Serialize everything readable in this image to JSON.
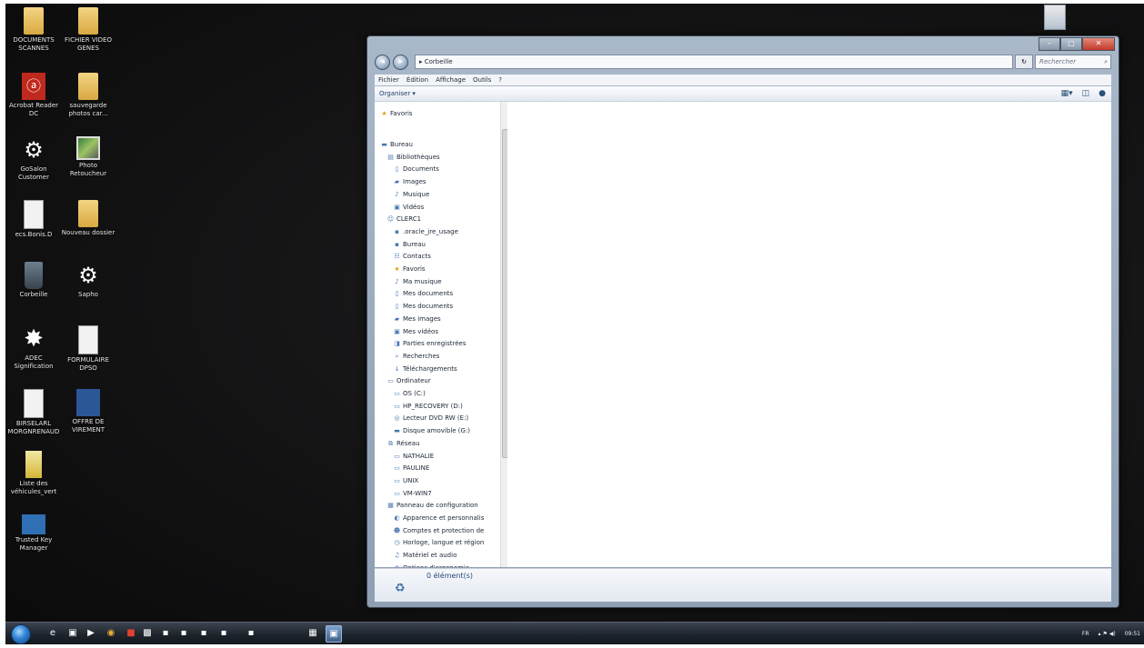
{
  "desktop": {
    "icons": [
      {
        "label": "DOCUMENTS SCANNES",
        "icon": "folder-document-icon"
      },
      {
        "label": "FICHIER VIDEO GENES",
        "icon": "folder-icon"
      },
      {
        "label": "Acrobat Reader DC",
        "icon": "pdf-icon"
      },
      {
        "label": "sauvegarde photos car...",
        "icon": "folder-icon"
      },
      {
        "label": "GoSalon Customer",
        "icon": "app-icon"
      },
      {
        "label": "Photo Retoucheur",
        "icon": "photo-icon"
      },
      {
        "label": "ecs.Bonis.D",
        "icon": "pdf-document-icon"
      },
      {
        "label": "Nouveau dossier",
        "icon": "folder-icon"
      },
      {
        "label": "Corbeille",
        "icon": "recycle-bin-icon"
      },
      {
        "label": "Sapho",
        "icon": "app-icon"
      },
      {
        "label": "ADEC Signification",
        "icon": "star-app-icon"
      },
      {
        "label": "FORMULAIRE DPSO",
        "icon": "pdf-document-icon"
      },
      {
        "label": "BIRSELARL MORGNRENAUD",
        "icon": "pdf-document-icon"
      },
      {
        "label": "OFFRE DE VIREMENT",
        "icon": "word-document-icon"
      },
      {
        "label": "Liste des véhicules_vert",
        "icon": "executable-icon"
      },
      {
        "label": "Trusted Key Manager",
        "icon": "key-manager-icon"
      }
    ]
  },
  "window": {
    "address": "▸ Corbeille",
    "search_placeholder": "Rechercher",
    "controls": [
      "–",
      "□",
      "✕"
    ],
    "menu": [
      "Fichier",
      "Édition",
      "Affichage",
      "Outils",
      "?"
    ],
    "toolbar": {
      "organize": "Organiser ▾"
    },
    "nav_tree": [
      {
        "label": "Favoris",
        "icon": "star-icon",
        "indent": 0
      },
      {
        "label": "Bureau",
        "icon": "desktop-icon",
        "indent": 0
      },
      {
        "label": "Bibliothèques",
        "icon": "library-icon",
        "indent": 1
      },
      {
        "label": "Documents",
        "icon": "document-icon",
        "indent": 2
      },
      {
        "label": "Images",
        "icon": "image-icon",
        "indent": 2
      },
      {
        "label": "Musique",
        "icon": "music-icon",
        "indent": 2
      },
      {
        "label": "Vidéos",
        "icon": "video-icon",
        "indent": 2
      },
      {
        "label": "CLERC1",
        "icon": "user-icon",
        "indent": 1
      },
      {
        "label": ".oracle_jre_usage",
        "icon": "folder-icon",
        "indent": 2
      },
      {
        "label": "Bureau",
        "icon": "folder-icon",
        "indent": 2
      },
      {
        "label": "Contacts",
        "icon": "contacts-icon",
        "indent": 2
      },
      {
        "label": "Favoris",
        "icon": "star-icon",
        "indent": 2
      },
      {
        "label": "Ma musique",
        "icon": "music-icon",
        "indent": 2
      },
      {
        "label": "Mes documents",
        "icon": "document-icon",
        "indent": 2
      },
      {
        "label": "Mes documents",
        "icon": "document-icon",
        "indent": 2
      },
      {
        "label": "Mes images",
        "icon": "image-icon",
        "indent": 2
      },
      {
        "label": "Mes vidéos",
        "icon": "video-icon",
        "indent": 2
      },
      {
        "label": "Parties enregistrées",
        "icon": "save-icon",
        "indent": 2
      },
      {
        "label": "Recherches",
        "icon": "search-icon",
        "indent": 2
      },
      {
        "label": "Téléchargements",
        "icon": "download-icon",
        "indent": 2
      },
      {
        "label": "Ordinateur",
        "icon": "computer-icon",
        "indent": 1
      },
      {
        "label": "OS (C:)",
        "icon": "drive-icon",
        "indent": 2
      },
      {
        "label": "HP_RECOVERY (D:)",
        "icon": "drive-icon",
        "indent": 2
      },
      {
        "label": "Lecteur DVD RW (E:)",
        "icon": "dvd-drive-icon",
        "indent": 2
      },
      {
        "label": "Disque amovible (G:)",
        "icon": "removable-drive-icon",
        "indent": 2
      },
      {
        "label": "Réseau",
        "icon": "network-icon",
        "indent": 1
      },
      {
        "label": "NATHALIE",
        "icon": "network-computer-icon",
        "indent": 2
      },
      {
        "label": "PAULINE",
        "icon": "network-computer-icon",
        "indent": 2
      },
      {
        "label": "UNIX",
        "icon": "network-computer-icon",
        "indent": 2
      },
      {
        "label": "VM-WIN7",
        "icon": "network-computer-icon",
        "indent": 2
      },
      {
        "label": "Panneau de configuration",
        "icon": "control-panel-icon",
        "indent": 1
      },
      {
        "label": "Apparence et personnalis",
        "icon": "appearance-icon",
        "indent": 2
      },
      {
        "label": "Comptes et protection de",
        "icon": "accounts-icon",
        "indent": 2
      },
      {
        "label": "Horloge, langue et région",
        "icon": "clock-icon",
        "indent": 2
      },
      {
        "label": "Matériel et audio",
        "icon": "hardware-icon",
        "indent": 2
      },
      {
        "label": "Options d'ergonomie",
        "icon": "accessibility-icon",
        "indent": 2
      }
    ],
    "status": "0 élément(s)"
  },
  "taskbar": {
    "buttons": [
      "ie-icon",
      "explorer-icon",
      "media-icon",
      "chrome-icon",
      "app-red-icon",
      "app-photo-icon",
      "app-icon",
      "app-icon",
      "app-icon",
      "app-icon",
      "app-icon",
      "app-blue-icon",
      "explorer-window-icon"
    ],
    "tray": {
      "language": "FR",
      "clock": "09:51"
    }
  }
}
